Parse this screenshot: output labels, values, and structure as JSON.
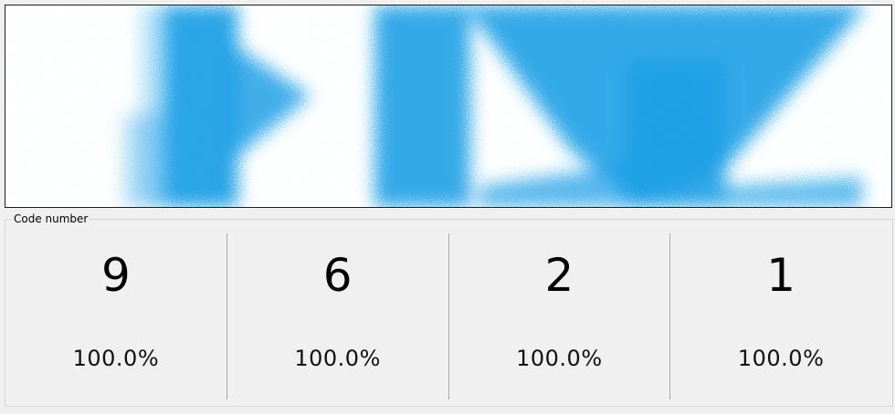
{
  "scan": {
    "ink_color": "#1fa0e6"
  },
  "group": {
    "caption": "Code number"
  },
  "results": [
    {
      "digit": "9",
      "confidence": "100.0%"
    },
    {
      "digit": "6",
      "confidence": "100.0%"
    },
    {
      "digit": "2",
      "confidence": "100.0%"
    },
    {
      "digit": "1",
      "confidence": "100.0%"
    }
  ]
}
